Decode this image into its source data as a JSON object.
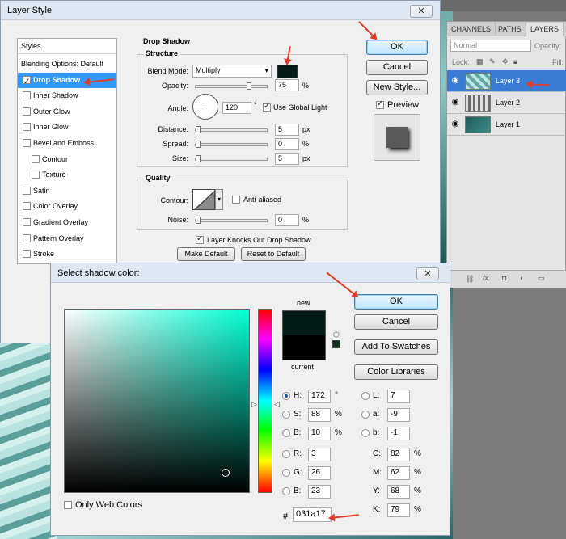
{
  "layer_style": {
    "title": "Layer Style",
    "styles_header": "Styles",
    "styles": [
      {
        "label": "Blending Options: Default",
        "check": false,
        "sel": false,
        "indent": 0,
        "hasbox": false
      },
      {
        "label": "Drop Shadow",
        "check": true,
        "sel": true,
        "indent": 0,
        "hasbox": true
      },
      {
        "label": "Inner Shadow",
        "check": false,
        "sel": false,
        "indent": 0,
        "hasbox": true
      },
      {
        "label": "Outer Glow",
        "check": false,
        "sel": false,
        "indent": 0,
        "hasbox": true
      },
      {
        "label": "Inner Glow",
        "check": false,
        "sel": false,
        "indent": 0,
        "hasbox": true
      },
      {
        "label": "Bevel and Emboss",
        "check": false,
        "sel": false,
        "indent": 0,
        "hasbox": true
      },
      {
        "label": "Contour",
        "check": false,
        "sel": false,
        "indent": 1,
        "hasbox": true
      },
      {
        "label": "Texture",
        "check": false,
        "sel": false,
        "indent": 1,
        "hasbox": true
      },
      {
        "label": "Satin",
        "check": false,
        "sel": false,
        "indent": 0,
        "hasbox": true
      },
      {
        "label": "Color Overlay",
        "check": false,
        "sel": false,
        "indent": 0,
        "hasbox": true
      },
      {
        "label": "Gradient Overlay",
        "check": false,
        "sel": false,
        "indent": 0,
        "hasbox": true
      },
      {
        "label": "Pattern Overlay",
        "check": false,
        "sel": false,
        "indent": 0,
        "hasbox": true
      },
      {
        "label": "Stroke",
        "check": false,
        "sel": false,
        "indent": 0,
        "hasbox": true
      }
    ],
    "drop_shadow_title": "Drop Shadow",
    "structure_title": "Structure",
    "blend_mode_label": "Blend Mode:",
    "blend_mode_value": "Multiply",
    "shadow_color": "#031a17",
    "opacity_label": "Opacity:",
    "opacity_value": "75",
    "opacity_level": 0.75,
    "angle_label": "Angle:",
    "angle_value": "120",
    "angle_unit": "°",
    "use_global_light": "Use Global Light",
    "distance_label": "Distance:",
    "distance_value": "5",
    "spread_label": "Spread:",
    "spread_value": "0",
    "size_label": "Size:",
    "size_value": "5",
    "px": "px",
    "pct": "%",
    "quality_title": "Quality",
    "contour_label": "Contour:",
    "anti_aliased": "Anti-aliased",
    "noise_label": "Noise:",
    "noise_value": "0",
    "knocks_out": "Layer Knocks Out Drop Shadow",
    "make_default": "Make Default",
    "reset_default": "Reset to Default",
    "ok": "OK",
    "cancel": "Cancel",
    "new_style": "New Style...",
    "preview": "Preview"
  },
  "layers_panel": {
    "tabs": [
      "CHANNELS",
      "PATHS",
      "LAYERS"
    ],
    "blend_mode": "Normal",
    "opacity_label": "Opacity:",
    "lock_label": "Lock:",
    "fill_label": "Fill:",
    "layers": [
      {
        "name": "Layer 3",
        "selected": true
      },
      {
        "name": "Layer 2",
        "selected": false
      },
      {
        "name": "Layer 1",
        "selected": false
      }
    ],
    "bottom_icons": [
      "link-icon",
      "fx-icon",
      "mask-icon",
      "adjustment-icon",
      "folder-icon"
    ]
  },
  "color_picker": {
    "title": "Select shadow color:",
    "ok": "OK",
    "cancel": "Cancel",
    "add_to_swatches": "Add To Swatches",
    "color_libraries": "Color Libraries",
    "new_label": "new",
    "current_label": "current",
    "new_color": "#031a17",
    "current_color": "#000000",
    "hsb": [
      {
        "label": "H:",
        "value": "172",
        "unit": "°",
        "on": true
      },
      {
        "label": "S:",
        "value": "88",
        "unit": "%",
        "on": false
      },
      {
        "label": "B:",
        "value": "10",
        "unit": "%",
        "on": false
      }
    ],
    "rgb": [
      {
        "label": "R:",
        "value": "3"
      },
      {
        "label": "G:",
        "value": "26"
      },
      {
        "label": "B:",
        "value": "23"
      }
    ],
    "lab": [
      {
        "label": "L:",
        "value": "7"
      },
      {
        "label": "a:",
        "value": "-9"
      },
      {
        "label": "b:",
        "value": "-1"
      }
    ],
    "cmyk": [
      {
        "label": "C:",
        "value": "82",
        "unit": "%"
      },
      {
        "label": "M:",
        "value": "62",
        "unit": "%"
      },
      {
        "label": "Y:",
        "value": "68",
        "unit": "%"
      },
      {
        "label": "K:",
        "value": "79",
        "unit": "%"
      }
    ],
    "hex_label": "#",
    "hex_value": "031a17",
    "only_web_colors": "Only Web Colors"
  }
}
